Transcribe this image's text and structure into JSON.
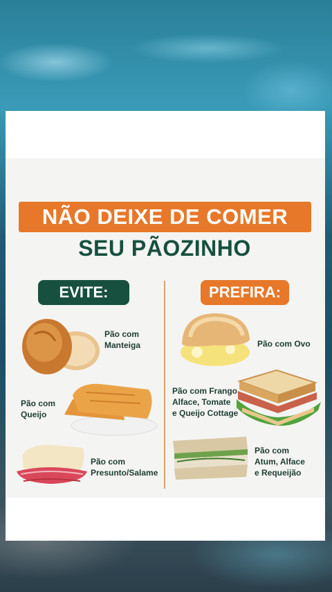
{
  "poster": {
    "title": "NÃO DEIXE DE COMER",
    "subtitle": "SEU PÃOZINHO",
    "avoid_label": "EVITE:",
    "prefer_label": "PREFIRA:"
  },
  "avoid_items": [
    {
      "label": "Pão com\nManteiga",
      "icon": "bread-butter"
    },
    {
      "label": "Pão com\nQueijo",
      "icon": "grilled-cheese"
    },
    {
      "label": "Pão com\nPresunto/Salame",
      "icon": "ham-sandwich"
    }
  ],
  "prefer_items": [
    {
      "label": "Pão com Ovo",
      "icon": "egg-sandwich"
    },
    {
      "label": "Pão com Frango,\nAlface, Tomate\ne Queijo Cottage",
      "icon": "chicken-sandwich"
    },
    {
      "label": "Pão com\nAtum, Alface\ne Requeijão",
      "icon": "tuna-sandwich"
    }
  ],
  "colors": {
    "orange": "#e7782a",
    "dark_green": "#17503f"
  }
}
